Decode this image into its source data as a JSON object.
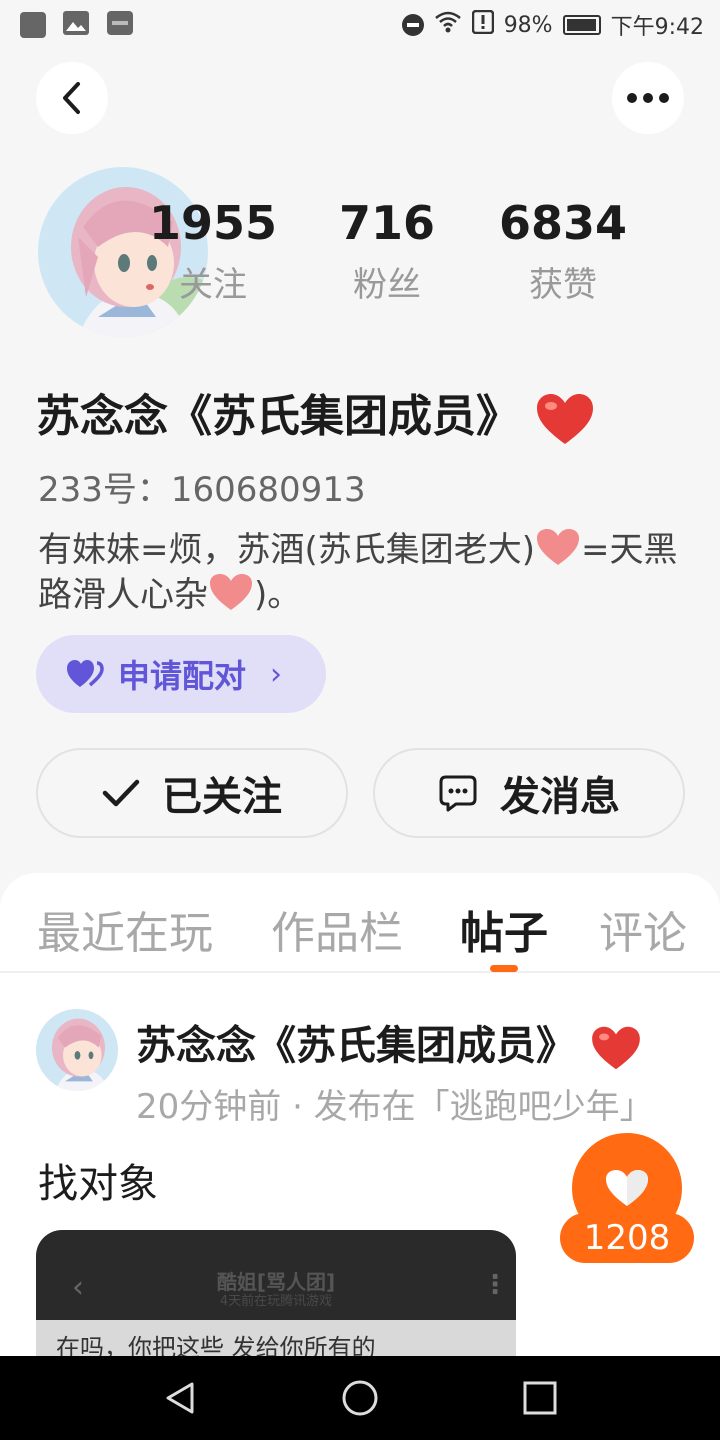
{
  "status_bar": {
    "battery": "98%",
    "time": "下午9:42",
    "icons": [
      "app-icon",
      "gallery-icon",
      "hms-icon",
      "dnd-icon",
      "wifi-icon",
      "alert-icon",
      "battery-icon"
    ],
    "battery_level": 0.98
  },
  "header": {
    "back_icon": "chevron-left-icon",
    "more_icon": "more-dots-icon"
  },
  "profile": {
    "name": "苏念念《苏氏集团成员》",
    "id_text": "233号：160680913",
    "bio_part1": "有妹妹=烦，苏酒(苏氏集团老大)",
    "bio_part2": "=天黑路滑人心杂",
    "bio_part3": ")。",
    "stats": [
      {
        "value": "1955",
        "label": "关注"
      },
      {
        "value": "716",
        "label": "粉丝"
      },
      {
        "value": "6834",
        "label": "获赞"
      }
    ]
  },
  "match_button": {
    "label": "申请配对",
    "chevron": "›"
  },
  "follow_button": {
    "label": "已关注"
  },
  "message_button": {
    "label": "发消息"
  },
  "tabs": [
    {
      "label": "最近在玩"
    },
    {
      "label": "作品栏"
    },
    {
      "label": "帖子",
      "active": true
    },
    {
      "label": "评论"
    }
  ],
  "post": {
    "author": "苏念念《苏氏集团成员》",
    "meta": "20分钟前 · 发布在「逃跑吧少年」",
    "title": "找对象",
    "image": {
      "chat_title": "酷姐[骂人团]",
      "chat_subtitle": "4天前在玩腾讯游戏",
      "message": "在吗，你把这些 发给你所有的"
    }
  },
  "like": {
    "count": "1208"
  },
  "colors": {
    "accent": "#ff6a13",
    "match_bg": "#e1dff7",
    "match_text": "#6156d8",
    "heart": "#e53935"
  }
}
